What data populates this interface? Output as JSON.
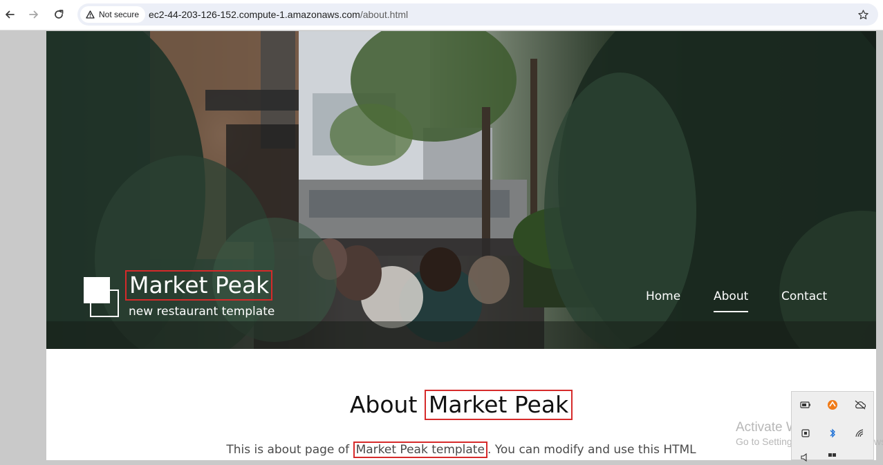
{
  "browser": {
    "security_label": "Not secure",
    "url_host": "ec2-44-203-126-152.compute-1.amazonaws.com",
    "url_path": "/about.html",
    "icons": [
      "back-icon",
      "forward-icon",
      "reload-icon",
      "warning-icon",
      "star-icon"
    ]
  },
  "site": {
    "brand_title": "Market Peak",
    "brand_subtitle": "new restaurant template",
    "nav": [
      {
        "label": "Home",
        "active": false
      },
      {
        "label": "About",
        "active": true
      },
      {
        "label": "Contact",
        "active": false
      }
    ]
  },
  "about": {
    "title_prefix": "About",
    "title_highlight": "Market Peak",
    "text_prefix": "This is about page of ",
    "text_highlight": "Market Peak template",
    "text_suffix": ". You can modify and use this HTML"
  },
  "overlay": {
    "activate_line1": "Activate Windows",
    "activate_line2": "Go to Settings to activate Windows."
  },
  "colors": {
    "highlight_border": "#d62a2a",
    "omnibox_bg": "#eceff7",
    "page_bg": "#ffffff"
  }
}
